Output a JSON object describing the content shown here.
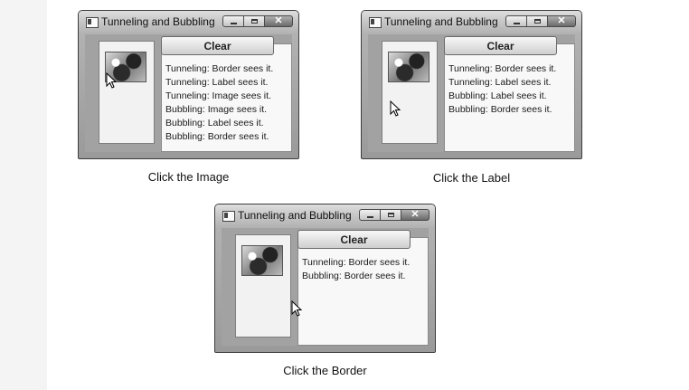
{
  "window_title": "Tunneling and Bubbling",
  "clear_label": "Clear",
  "controls": {
    "minimize_icon": "minimize-icon",
    "maximize_icon": "maximize-icon",
    "close_icon": "close-icon",
    "close_glyph": "✕"
  },
  "panels": [
    {
      "caption": "Click the Image",
      "log": [
        "Tunneling: Border sees it.",
        "Tunneling: Label sees it.",
        "Tunneling: Image sees it.",
        "Bubbling: Image sees it.",
        "Bubbling: Label sees it.",
        "Bubbling: Border sees it."
      ]
    },
    {
      "caption": "Click the Label",
      "log": [
        "Tunneling: Border sees it.",
        "Tunneling: Label sees it.",
        "Bubbling: Label sees it.",
        "Bubbling: Border sees it."
      ]
    },
    {
      "caption": "Click the Border",
      "log": [
        "Tunneling: Border sees it.",
        "Bubbling: Border sees it."
      ]
    }
  ]
}
